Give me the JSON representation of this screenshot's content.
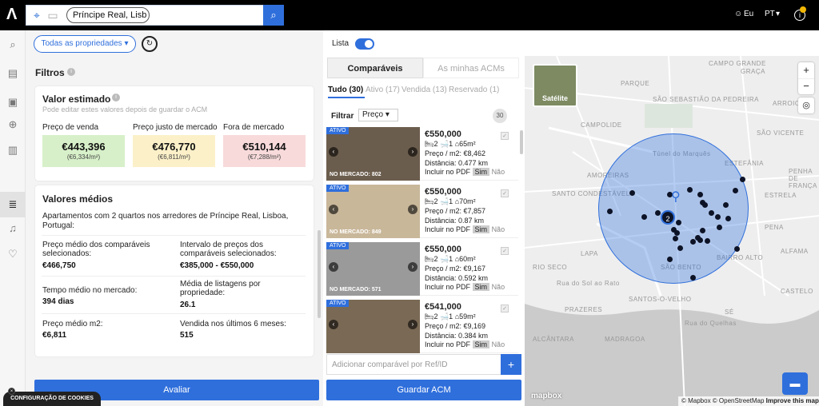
{
  "header": {
    "search_value": "Príncipe Real, Lisb ...",
    "user_label": "Eu",
    "lang_label": "PT",
    "info_count": "1"
  },
  "left": {
    "property_dropdown": "Todas as propriedades",
    "filters_title": "Filtros",
    "valor": {
      "title": "Valor estimado",
      "hint": "Pode editar estes valores depois de guardar o ACM",
      "boxes": [
        {
          "label": "Preço de venda",
          "value": "€443,396",
          "sub": "(€6,334/m²)",
          "color": "#d7f0c9"
        },
        {
          "label": "Preço justo de mercado",
          "value": "€476,770",
          "sub": "(€6,811/m²)",
          "color": "#fbf0c8"
        },
        {
          "label": "Fora de mercado",
          "value": "€510,144",
          "sub": "(€7,288/m²)",
          "color": "#f8dada"
        }
      ]
    },
    "medios": {
      "title": "Valores médios",
      "desc": "Apartamentos com 2 quartos nos arredores de Príncipe Real, Lisboa, Portugal:",
      "items": [
        {
          "label": "Preço médio dos comparáveis selecionados:",
          "value": "€466,750"
        },
        {
          "label": "Intervalo de preços dos comparáveis selecionados:",
          "value": "€385,000 - €550,000"
        },
        {
          "label": "Tempo médio no mercado:",
          "value": "394 dias"
        },
        {
          "label": "Média de listagens por propriedade:",
          "value": "26.1"
        },
        {
          "label": "Preço médio m2:",
          "value": "€6,811"
        },
        {
          "label": "Vendida nos últimos 6 meses:",
          "value": "515"
        }
      ]
    },
    "avaliar_button": "Avaliar",
    "cookies": "CONFIGURAÇÃO DE COOKIES"
  },
  "middle": {
    "lista_label": "Lista",
    "tabs": [
      "Comparáveis",
      "As minhas ACMs"
    ],
    "subtabs": [
      "Tudo (30)",
      "Ativo (17)",
      "Vendida (13)",
      "Reservado (1)"
    ],
    "filter_label": "Filtrar",
    "sort_label": "Preço",
    "count": "30",
    "listings": [
      {
        "tag": "ATIVO",
        "nomer": "NO MERCADO: 802",
        "price": "€550,000",
        "area": "65m²",
        "ppm": "Preço / m2: €8,462",
        "dist": "Distância: 0.477 km"
      },
      {
        "tag": "ATIVO",
        "nomer": "NO MERCADO: 849",
        "price": "€550,000",
        "area": "70m²",
        "ppm": "Preço / m2: €7,857",
        "dist": "Distância: 0.87 km"
      },
      {
        "tag": "ATIVO",
        "nomer": "NO MERCADO: 571",
        "price": "€550,000",
        "area": "60m²",
        "ppm": "Preço / m2: €9,167",
        "dist": "Distância: 0.592 km"
      },
      {
        "tag": "ATIVO",
        "nomer": "",
        "price": "€541,000",
        "area": "59m²",
        "ppm": "Preço / m2: €9,169",
        "dist": "Distância: 0.384 km"
      }
    ],
    "beds": "2",
    "baths": "1",
    "pdf_label": "Incluir no PDF",
    "sim": "Sim",
    "nao": "Não",
    "add_placeholder": "Adicionar comparável por Ref/ID",
    "guardar_button": "Guardar ACM"
  },
  "map": {
    "satellite_label": "Satélite",
    "cluster": "2",
    "labels": [
      "GRAÇA",
      "SÃO SEBASTIÃO DA PEDREIRA",
      "CAMPOLIDE",
      "Túnel do Marquês",
      "AMOREIRAS",
      "SANTO CONDESTÁVEL",
      "LAPA",
      "SÃO BENTO",
      "BAIRRO ALTO",
      "PRAZERES",
      "SANTOS-O-VELHO",
      "SÉ",
      "SÃO VICENTE",
      "ARROIOS",
      "PENHA DE FRANÇA",
      "PARQUE",
      "ESTRELA",
      "Rua do Sol ao Rato",
      "RIO SECO",
      "Rua do Quelhas",
      "ALFAMA",
      "ALCÂNTARA",
      "MADRAGOA",
      "CAMPO GRANDE",
      "ESTEFÂNIA",
      "PENA",
      "CASTELO"
    ],
    "attribution": "© Mapbox © OpenStreetMap",
    "improve": "Improve this map",
    "mapbox": "mapbox",
    "radius_color": "#2f6fdc"
  }
}
